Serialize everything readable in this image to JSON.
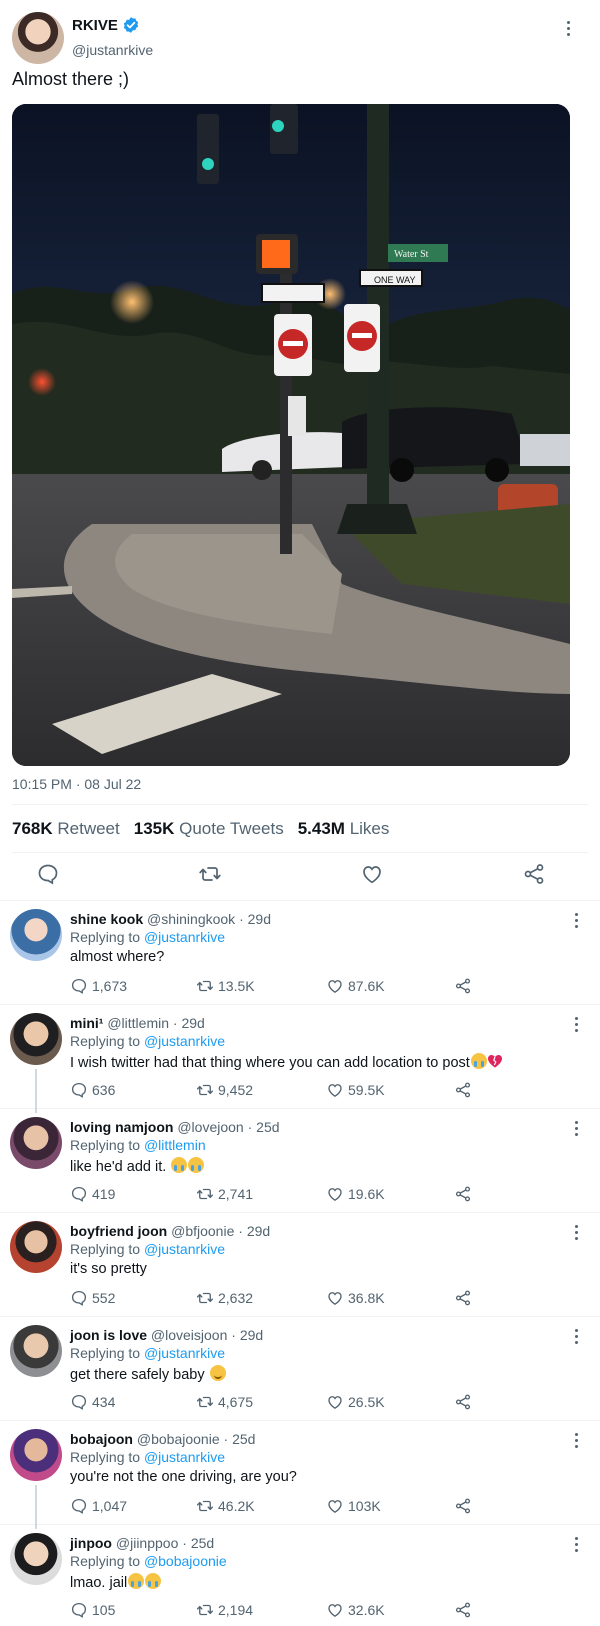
{
  "tweet": {
    "author_name": "RKIVE",
    "author_handle": "@justanrkive",
    "text": "Almost there ;)",
    "timestamp": "10:15 PM · 08 Jul 22",
    "stats": {
      "retweets_count": "768K",
      "retweets_label": "Retweet",
      "quotes_count": "135K",
      "quotes_label": "Quote Tweets",
      "likes_count": "5.43M",
      "likes_label": "Likes"
    },
    "photo_signs": {
      "street": "Water St",
      "one_way": "ONE WAY",
      "do_not_enter": "DO NOT ENTER"
    }
  },
  "replies_prefix": "Replying to",
  "replies": [
    {
      "name": "shine kook",
      "handle": "@shiningkook",
      "age": "29d",
      "replying_to": "@justanrkive",
      "text": "almost where?",
      "replies": "1,673",
      "retweets": "13.5K",
      "likes": "87.6K"
    },
    {
      "name": "mini¹",
      "handle": "@littlemin",
      "age": "29d",
      "replying_to": "@justanrkive",
      "text": "I wish twitter had that thing where you can add location to post",
      "replies": "636",
      "retweets": "9,452",
      "likes": "59.5K"
    },
    {
      "name": "loving namjoon",
      "handle": "@lovejoon",
      "age": "25d",
      "replying_to": "@littlemin",
      "text": "like he'd add it.",
      "replies": "419",
      "retweets": "2,741",
      "likes": "19.6K"
    },
    {
      "name": "boyfriend joon",
      "handle": "@bfjoonie",
      "age": "29d",
      "replying_to": "@justanrkive",
      "text": "it's so pretty",
      "replies": "552",
      "retweets": "2,632",
      "likes": "36.8K"
    },
    {
      "name": "joon is love",
      "handle": "@loveisjoon",
      "age": "29d",
      "replying_to": "@justanrkive",
      "text": "get there safely baby",
      "replies": "434",
      "retweets": "4,675",
      "likes": "26.5K"
    },
    {
      "name": "bobajoon",
      "handle": "@bobajoonie",
      "age": "25d",
      "replying_to": "@justanrkive",
      "text": "you're not the one driving, are you?",
      "replies": "1,047",
      "retweets": "46.2K",
      "likes": "103K"
    },
    {
      "name": "jinpoo",
      "handle": "@jiinppoo",
      "age": "25d",
      "replying_to": "@bobajoonie",
      "text": "lmao. jail",
      "replies": "105",
      "retweets": "2,194",
      "likes": "32.6K"
    }
  ],
  "colors": {
    "accent": "#1d9bf0",
    "muted": "#536471",
    "text": "#0f1419"
  }
}
